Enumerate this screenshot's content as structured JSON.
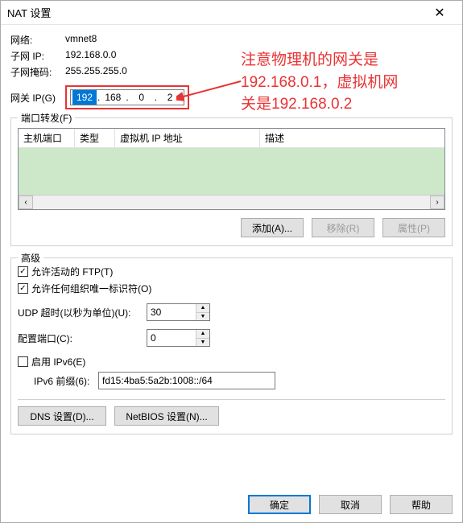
{
  "window": {
    "title": "NAT 设置"
  },
  "info": {
    "network_label": "网络:",
    "network_value": "vmnet8",
    "subnet_ip_label": "子网 IP:",
    "subnet_ip_value": "192.168.0.0",
    "subnet_mask_label": "子网掩码:",
    "subnet_mask_value": "255.255.255.0",
    "gateway_label": "网关 IP(G)",
    "gateway_octets": [
      "192",
      "168",
      "0",
      "2"
    ]
  },
  "port_forward": {
    "group_title": "端口转发(F)",
    "columns": {
      "host_port": "主机端口",
      "type": "类型",
      "vm_ip": "虚拟机 IP 地址",
      "desc": "描述"
    },
    "buttons": {
      "add": "添加(A)...",
      "remove": "移除(R)",
      "properties": "属性(P)"
    }
  },
  "advanced": {
    "group_title": "高级",
    "allow_active_ftp": "允许活动的 FTP(T)",
    "allow_any_oui": "允许任何组织唯一标识符(O)",
    "udp_timeout_label": "UDP 超时(以秒为单位)(U):",
    "udp_timeout_value": "30",
    "config_port_label": "配置端口(C):",
    "config_port_value": "0",
    "enable_ipv6": "启用 IPv6(E)",
    "ipv6_prefix_label": "IPv6 前缀(6):",
    "ipv6_prefix_value": "fd15:4ba5:5a2b:1008::/64",
    "dns_btn": "DNS 设置(D)...",
    "netbios_btn": "NetBIOS 设置(N)..."
  },
  "dialog_buttons": {
    "ok": "确定",
    "cancel": "取消",
    "help": "帮助"
  },
  "annotation": {
    "line1": "注意物理机的网关是",
    "line2": "192.168.0.1，虚拟机网",
    "line3": "关是192.168.0.2"
  }
}
